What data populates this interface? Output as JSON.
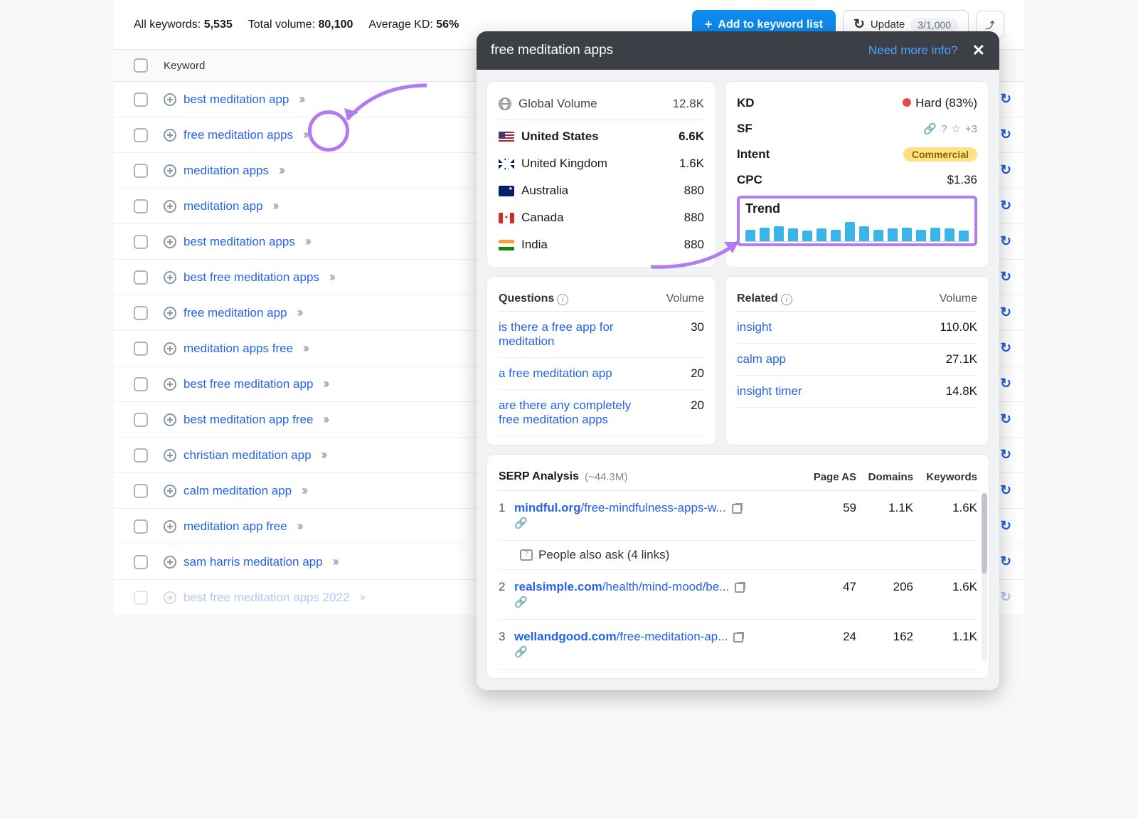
{
  "topbar": {
    "all_keywords_label": "All keywords:",
    "all_keywords_value": "5,535",
    "total_volume_label": "Total volume:",
    "total_volume_value": "80,100",
    "avg_kd_label": "Average KD:",
    "avg_kd_value": "56%",
    "add_btn": "Add to keyword list",
    "update_btn": "Update",
    "update_pill": "3/1,000"
  },
  "table": {
    "col_keyword": "Keyword",
    "rows": [
      {
        "text": "best meditation app"
      },
      {
        "text": "free meditation apps"
      },
      {
        "text": "meditation apps"
      },
      {
        "text": "meditation app"
      },
      {
        "text": "best meditation apps"
      },
      {
        "text": "best free meditation apps"
      },
      {
        "text": "free meditation app"
      },
      {
        "text": "meditation apps free"
      },
      {
        "text": "best free meditation app"
      },
      {
        "text": "best meditation app free"
      },
      {
        "text": "christian meditation app"
      },
      {
        "text": "calm meditation app"
      },
      {
        "text": "meditation app free"
      },
      {
        "text": "sam harris meditation app"
      },
      {
        "text": "best free meditation apps 2022"
      }
    ]
  },
  "popup": {
    "title": "free meditation apps",
    "need_more": "Need more info?",
    "global_volume_label": "Global Volume",
    "global_volume_value": "12.8K",
    "countries": [
      {
        "code": "us",
        "name": "United States",
        "value": "6.6K",
        "bold": true
      },
      {
        "code": "uk",
        "name": "United Kingdom",
        "value": "1.6K"
      },
      {
        "code": "au",
        "name": "Australia",
        "value": "880"
      },
      {
        "code": "ca",
        "name": "Canada",
        "value": "880"
      },
      {
        "code": "in",
        "name": "India",
        "value": "880"
      }
    ],
    "metrics": {
      "kd_label": "KD",
      "kd_value": "Hard (83%)",
      "sf_label": "SF",
      "sf_plus": "+3",
      "intent_label": "Intent",
      "intent_value": "Commercial",
      "cpc_label": "CPC",
      "cpc_value": "$1.36",
      "trend_label": "Trend"
    },
    "questions": {
      "header": "Questions",
      "vol_h": "Volume",
      "items": [
        {
          "q": "is there a free app for meditation",
          "v": "30"
        },
        {
          "q": "a free meditation app",
          "v": "20"
        },
        {
          "q": "are there any completely free meditation apps",
          "v": "20"
        }
      ]
    },
    "related": {
      "header": "Related",
      "vol_h": "Volume",
      "items": [
        {
          "q": "insight",
          "v": "110.0K"
        },
        {
          "q": "calm app",
          "v": "27.1K"
        },
        {
          "q": "insight timer",
          "v": "14.8K"
        }
      ]
    },
    "serp": {
      "header": "SERP Analysis",
      "count": "(~44.3M)",
      "col_as": "Page AS",
      "col_dom": "Domains",
      "col_kw": "Keywords",
      "paa": "People also ask (4 links)",
      "rows": [
        {
          "n": "1",
          "dom": "mindful.org",
          "path": "/free-mindfulness-apps-w...",
          "as": "59",
          "doms": "1.1K",
          "kws": "1.6K"
        },
        {
          "n": "2",
          "dom": "realsimple.com",
          "path": "/health/mind-mood/be...",
          "as": "47",
          "doms": "206",
          "kws": "1.6K"
        },
        {
          "n": "3",
          "dom": "wellandgood.com",
          "path": "/free-meditation-ap...",
          "as": "24",
          "doms": "162",
          "kws": "1.1K"
        }
      ]
    }
  },
  "chart_data": {
    "type": "bar",
    "title": "Trend",
    "categories": [
      "1",
      "2",
      "3",
      "4",
      "5",
      "6",
      "7",
      "8",
      "9",
      "10",
      "11",
      "12",
      "13",
      "14",
      "15",
      "16"
    ],
    "values": [
      55,
      65,
      70,
      60,
      50,
      60,
      55,
      90,
      70,
      55,
      60,
      65,
      55,
      65,
      60,
      50
    ],
    "ylim": [
      0,
      100
    ]
  }
}
